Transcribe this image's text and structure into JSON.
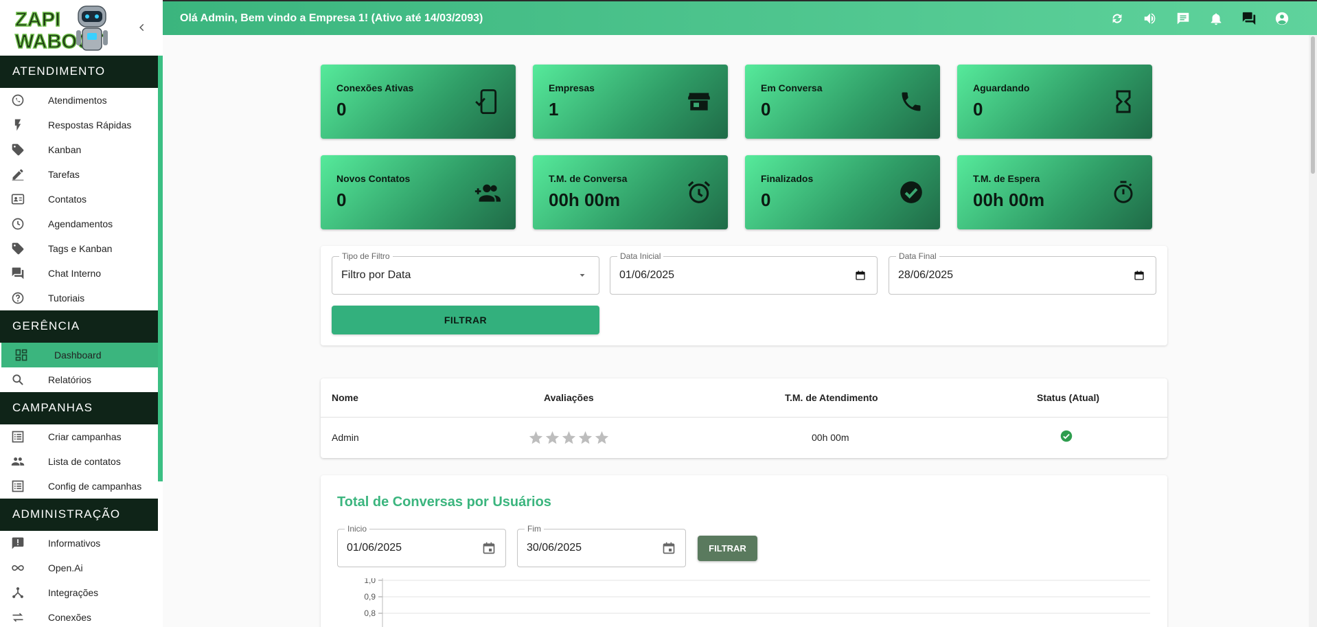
{
  "topbar": {
    "greeting": "Olá Admin, Bem vindo a Empresa 1! (Ativo até 14/03/2093)",
    "icons": [
      "refresh-icon",
      "volume-icon",
      "chat-icon",
      "bell-icon",
      "forum-icon",
      "account-icon"
    ]
  },
  "logo": {
    "line1": "ZAPI",
    "line2": "WABOOT"
  },
  "sidebar": {
    "sections": [
      {
        "title": "ATENDIMENTO",
        "items": [
          {
            "label": "Atendimentos",
            "icon": "whatsapp-icon"
          },
          {
            "label": "Respostas Rápidas",
            "icon": "flash-icon"
          },
          {
            "label": "Kanban",
            "icon": "tag-icon"
          },
          {
            "label": "Tarefas",
            "icon": "pencil-icon"
          },
          {
            "label": "Contatos",
            "icon": "contact-card-icon"
          },
          {
            "label": "Agendamentos",
            "icon": "clock-icon"
          },
          {
            "label": "Tags e Kanban",
            "icon": "tag-icon"
          },
          {
            "label": "Chat Interno",
            "icon": "forum-icon"
          },
          {
            "label": "Tutoriais",
            "icon": "help-icon"
          }
        ]
      },
      {
        "title": "GERÊNCIA",
        "items": [
          {
            "label": "Dashboard",
            "icon": "dashboard-icon",
            "active": true
          },
          {
            "label": "Relatórios",
            "icon": "search-icon"
          }
        ]
      },
      {
        "title": "CAMPANHAS",
        "items": [
          {
            "label": "Criar campanhas",
            "icon": "list-icon"
          },
          {
            "label": "Lista de contatos",
            "icon": "people-icon"
          },
          {
            "label": "Config de campanhas",
            "icon": "list-icon"
          }
        ]
      },
      {
        "title": "ADMINISTRAÇÃO",
        "items": [
          {
            "label": "Informativos",
            "icon": "announcement-icon"
          },
          {
            "label": "Open.Ai",
            "icon": "infinity-icon"
          },
          {
            "label": "Integrações",
            "icon": "hub-icon"
          },
          {
            "label": "Conexões",
            "icon": "swap-icon"
          }
        ]
      }
    ]
  },
  "cards": [
    {
      "label": "Conexões Ativas",
      "value": "0",
      "icon": "phone-check-icon"
    },
    {
      "label": "Empresas",
      "value": "1",
      "icon": "store-icon"
    },
    {
      "label": "Em Conversa",
      "value": "0",
      "icon": "phone-icon"
    },
    {
      "label": "Aguardando",
      "value": "0",
      "icon": "hourglass-icon"
    },
    {
      "label": "Novos Contatos",
      "value": "0",
      "icon": "group-add-icon"
    },
    {
      "label": "T.M. de Conversa",
      "value": "00h 00m",
      "icon": "alarm-icon"
    },
    {
      "label": "Finalizados",
      "value": "0",
      "icon": "check-circle-icon"
    },
    {
      "label": "T.M. de Espera",
      "value": "00h 00m",
      "icon": "timer-icon"
    }
  ],
  "filter": {
    "type_label": "Tipo de Filtro",
    "type_value": "Filtro por Data",
    "start_label": "Data Inicial",
    "start_value": "01/06/2025",
    "end_label": "Data Final",
    "end_value": "28/06/2025",
    "button": "FILTRAR"
  },
  "table": {
    "headers": [
      "Nome",
      "Avaliações",
      "T.M. de Atendimento",
      "Status (Atual)"
    ],
    "rows": [
      {
        "name": "Admin",
        "rating": 0,
        "max_rating": 5,
        "tm": "00h 00m",
        "status": "online"
      }
    ]
  },
  "chart_panel": {
    "title": "Total de Conversas por Usuários",
    "inicio_label": "Inicio",
    "inicio_value": "01/06/2025",
    "fim_label": "Fim",
    "fim_value": "30/06/2025",
    "button": "FILTRAR"
  },
  "chart_data": {
    "type": "bar",
    "categories": [],
    "values": [],
    "title": "Total de Conversas por Usuários",
    "xlabel": "",
    "ylabel": "",
    "ylim": [
      0,
      1
    ],
    "visible_ticks": [
      "1,0",
      "0,9",
      "0,8"
    ],
    "grid": true
  },
  "colors": {
    "accent": "#3bb57e",
    "sidebar_header": "#0f2418",
    "status_ok": "#2e9d4e"
  }
}
